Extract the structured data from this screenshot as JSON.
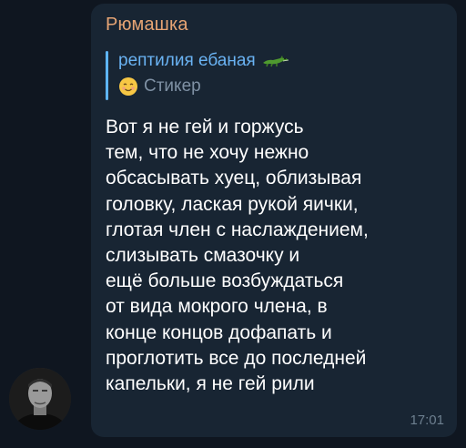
{
  "message": {
    "sender": "Рюмашка",
    "reply": {
      "author": "рептилия ебаная",
      "author_icon": "crocodile-icon",
      "preview_icon": "smiling-face-emoji-icon",
      "preview_text": "Стикер"
    },
    "text": "Вот я не гей и горжусь\nтем, что не хочу нежно\nобсасывать хуец, облизывая\nголовку, лаская рукой яички,\nглотая член с наслаждением,\nслизывать смазочку и\nещё больше возбуждаться\nот вида мокрого члена, в\nконце концов дофапать и\nпроглотить все до последней\nкапельки, я не гей рили",
    "time": "17:01"
  },
  "colors": {
    "background": "#0f1620",
    "bubble": "#182533",
    "sender": "#e6a474",
    "reply_accent": "#5eb5f7",
    "text": "#ffffff",
    "meta": "#6d7f8f"
  }
}
